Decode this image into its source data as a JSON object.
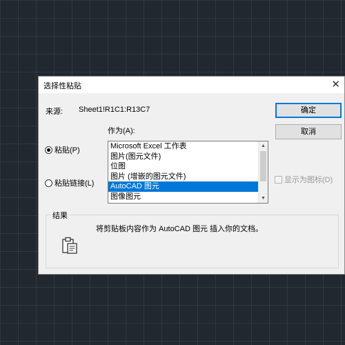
{
  "dialog": {
    "title": "选择性粘贴",
    "source_label": "来源:",
    "source_value": "Sheet1!R1C1:R13C7",
    "as_label": "作为(A):",
    "ok_button": "确定",
    "cancel_button": "取消",
    "paste_radio": {
      "label": "粘贴(P)",
      "checked": true
    },
    "paste_link_radio": {
      "label": "粘贴链接(L)",
      "checked": false
    },
    "list_items": [
      "Microsoft Excel 工作表",
      "图片(图元文件)",
      "位图",
      "图片 (增嵌的图元文件)",
      "AutoCAD 图元",
      "图像图元"
    ],
    "selected_item_index": 4,
    "display_as_icon": {
      "label": "显示为图标(D)",
      "checked": false,
      "enabled": false
    },
    "result_group_label": "结果",
    "result_text": "将剪贴板内容作为 AutoCAD 图元 插入你的文档。"
  },
  "icons": {
    "close": "close-icon",
    "clipboard": "clipboard-icon",
    "scroll_up": "chevron-up-icon",
    "scroll_down": "chevron-down-icon"
  },
  "colors": {
    "background": "#212830",
    "dialog": "#f0f0f0",
    "selection": "#0078d7"
  }
}
